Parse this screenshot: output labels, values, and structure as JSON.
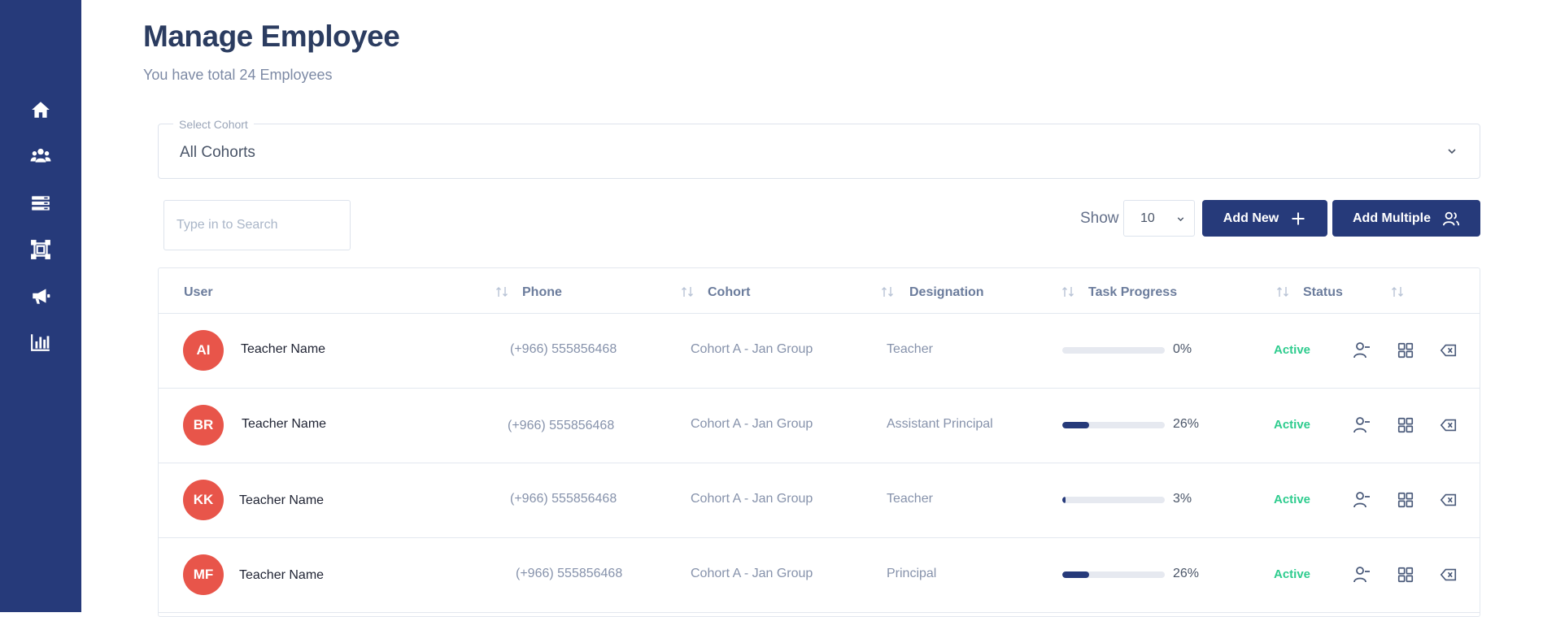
{
  "page": {
    "title": "Manage Employee",
    "subtitle": "You have total 24 Employees"
  },
  "sidebar": {
    "items": [
      {
        "icon": "home-icon"
      },
      {
        "icon": "users-icon"
      },
      {
        "icon": "layers-icon"
      },
      {
        "icon": "frame-icon"
      },
      {
        "icon": "megaphone-icon"
      },
      {
        "icon": "bar-chart-icon"
      }
    ]
  },
  "cohort_filter": {
    "label": "Select Cohort",
    "value": "All Cohorts"
  },
  "search": {
    "placeholder": "Type in to Search",
    "value": ""
  },
  "toolbar": {
    "show_label": "Show",
    "page_size": "10",
    "add_new_label": "Add New",
    "add_multiple_label": "Add Multiple"
  },
  "table": {
    "columns": [
      "User",
      "Phone",
      "Cohort",
      "Designation",
      "Task Progress",
      "Status"
    ],
    "rows": [
      {
        "initials": "AI",
        "name": "Teacher Name",
        "phone": "(+966) 555856468",
        "cohort": "Cohort A - Jan Group",
        "designation": "Teacher",
        "progress": 0,
        "progress_label": "0%",
        "status": "Active"
      },
      {
        "initials": "BR",
        "name": "Teacher Name",
        "phone": "(+966) 555856468",
        "cohort": "Cohort A - Jan Group",
        "designation": "Assistant Principal",
        "progress": 26,
        "progress_label": "26%",
        "status": "Active"
      },
      {
        "initials": "KK",
        "name": "Teacher Name",
        "phone": "(+966) 555856468",
        "cohort": "Cohort A - Jan Group",
        "designation": "Teacher",
        "progress": 3,
        "progress_label": "3%",
        "status": "Active"
      },
      {
        "initials": "MF",
        "name": "Teacher Name",
        "phone": "(+966) 555856468",
        "cohort": "Cohort A - Jan Group",
        "designation": "Principal",
        "progress": 26,
        "progress_label": "26%",
        "status": "Active"
      }
    ]
  },
  "colors": {
    "sidebar_bg": "#263a7a",
    "primary": "#263a7a",
    "avatar": "#e8554a",
    "status_active": "#2ecc8e"
  }
}
